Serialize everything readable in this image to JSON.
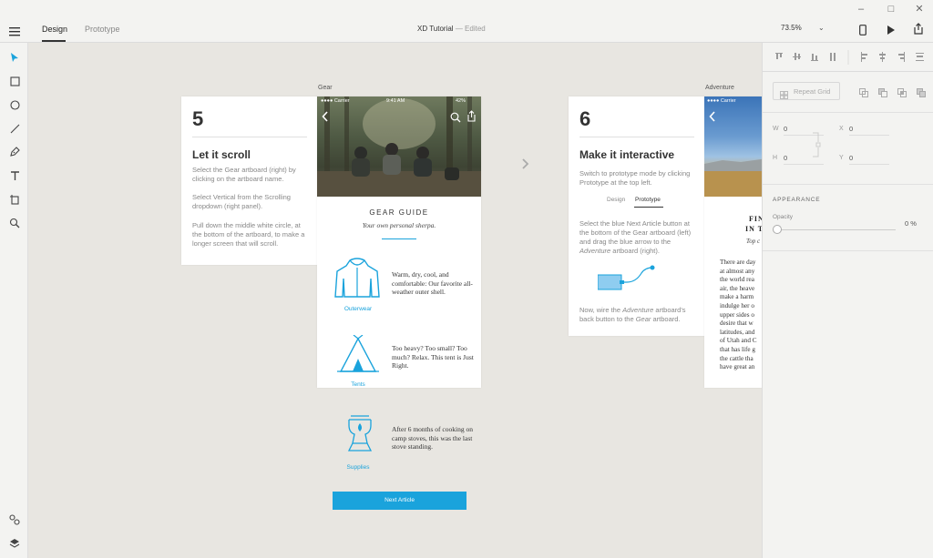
{
  "window": {
    "minimize": "–",
    "maximize": "□",
    "close": "✕"
  },
  "topbar": {
    "tab_design": "Design",
    "tab_prototype": "Prototype",
    "doc_title": "XD Tutorial",
    "separator": "—",
    "doc_status": "Edited",
    "zoom": "73.5%"
  },
  "artboards": {
    "gear_label": "Gear",
    "adventure_label": "Adventure"
  },
  "card5": {
    "number": "5",
    "title": "Let it scroll",
    "p1": "Select the Gear artboard (right) by clicking on the artboard name.",
    "p2": "Select Vertical from the Scrolling dropdown (right panel).",
    "p3": "Pull down the middle white circle, at the bottom of the artboard, to make a longer screen that will scroll."
  },
  "gear": {
    "status_carrier": "●●●● Carrier",
    "status_time": "9:41 AM",
    "status_battery": "42%",
    "heading": "GEAR GUIDE",
    "tagline": "Your own personal sherpa.",
    "items": [
      {
        "caption": "Outerwear",
        "text": "Warm, dry, cool, and comfortable: Our favorite all-weather outer shell."
      },
      {
        "caption": "Tents",
        "text": "Too heavy? Too small? Too much? Relax. This tent is Just Right."
      },
      {
        "caption": "Supplies",
        "text": "After 6 months of cooking on camp stoves, this was the last stove standing."
      }
    ],
    "button": "Next Article"
  },
  "card6": {
    "number": "6",
    "title": "Make it interactive",
    "p1": "Switch to prototype mode by clicking Prototype at the top left.",
    "mini_tab1": "Design",
    "mini_tab2": "Prototype",
    "p2a": "Select the blue Next Article button at the bottom of the Gear artboard (left) and drag the blue arrow to the ",
    "p2b": "Adventure",
    "p2c": " artboard (right).",
    "p3a": "Now, wire the ",
    "p3b": "Adventure",
    "p3c": " artboard's back button to the ",
    "p3d": "Gear",
    "p3e": " artboard."
  },
  "adventure": {
    "status_carrier": "●●●● Carrier",
    "heading1": "FIN",
    "heading2": "IN T",
    "sub": "Top c",
    "lines": [
      "There are day",
      "at almost any",
      "the world rea",
      "air, the heave",
      "make a harm",
      "indulge her o",
      "upper sides o",
      "desire that w",
      "latitudes, and",
      "of Utah and C",
      "that has life g",
      "the cattle tha",
      "have great an"
    ]
  },
  "rightpanel": {
    "repeat_grid": "Repeat Grid",
    "w_label": "W",
    "w_val": "0",
    "h_label": "H",
    "h_val": "0",
    "x_label": "X",
    "x_val": "0",
    "y_label": "Y",
    "y_val": "0",
    "appearance": "APPEARANCE",
    "opacity_label": "Opacity",
    "opacity_val": "0 %"
  },
  "colors": {
    "accent": "#1aa3dc",
    "canvas": "#e8e6e1",
    "panel": "#f3f3f1"
  }
}
